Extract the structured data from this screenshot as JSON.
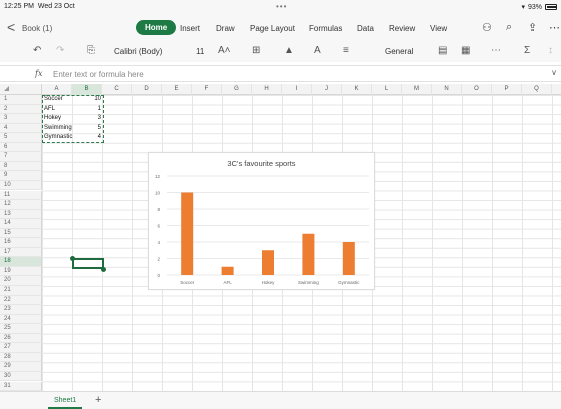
{
  "status_bar": {
    "time": "12:25 PM",
    "date": "Wed 23 Oct",
    "more": "•••",
    "battery": "93%",
    "battery_level": 0.93
  },
  "ribbon": {
    "back_label": "<",
    "document_name": "Book (1)",
    "tabs": [
      "Home",
      "Insert",
      "Draw",
      "Page Layout",
      "Formulas",
      "Data",
      "Review",
      "View"
    ],
    "active_tab": "Home",
    "accent_color": "#1e7a45"
  },
  "toolbar": {
    "font_name": "Calibri (Body)",
    "font_size": "11",
    "number_format": "General",
    "icons": [
      "undo-icon",
      "redo-icon",
      "clipboard-icon",
      "font-size-icon",
      "borders-icon",
      "fill-color-icon",
      "font-color-icon",
      "align-icon",
      "format-icon",
      "table-icon",
      "more-icon",
      "autosum-icon",
      "sort-icon"
    ]
  },
  "formula_bar": {
    "fx": "fx",
    "placeholder": "Enter text or formula here"
  },
  "columns": [
    "A",
    "B",
    "C",
    "D",
    "E",
    "F",
    "G",
    "H",
    "I",
    "J",
    "K",
    "L",
    "M",
    "N",
    "O",
    "P",
    "Q"
  ],
  "rows": [
    "1",
    "2",
    "3",
    "4",
    "5",
    "6",
    "7",
    "8",
    "9",
    "10",
    "11",
    "12",
    "13",
    "14",
    "15",
    "16",
    "17",
    "18",
    "19",
    "20",
    "21",
    "22",
    "23",
    "24",
    "25",
    "26",
    "27",
    "28",
    "29",
    "30",
    "31"
  ],
  "selected_column": "B",
  "selected_row": "18",
  "cells": [
    {
      "label": "Soccer",
      "value": "10"
    },
    {
      "label": "AFL",
      "value": "1"
    },
    {
      "label": "Hokey",
      "value": "3"
    },
    {
      "label": "Swimming",
      "value": "5"
    },
    {
      "label": "Gymnastic",
      "value": "4"
    }
  ],
  "chart_data": {
    "type": "bar",
    "title": "3C's favourite sports",
    "categories": [
      "Soccer",
      "AFL",
      "Hokey",
      "Swimming",
      "Gymnastic"
    ],
    "values": [
      10,
      1,
      3,
      5,
      4
    ],
    "yticks": [
      0,
      2,
      4,
      6,
      8,
      10,
      12
    ],
    "ylim": [
      0,
      12
    ],
    "bar_color": "#ed7d31",
    "grid": true,
    "legend": "none",
    "xlabel": "",
    "ylabel": ""
  },
  "sheets": {
    "active": "Sheet1",
    "add": "+"
  }
}
